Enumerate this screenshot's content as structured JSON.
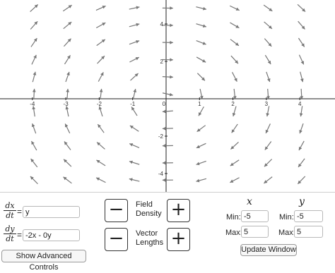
{
  "plot": {
    "x_ticks": [
      "-4",
      "-3",
      "-2",
      "-1",
      "0",
      "1",
      "2",
      "3",
      "4"
    ],
    "y_ticks": [
      "4",
      "2",
      "-2",
      "-4"
    ],
    "system": {
      "dx": "y",
      "dy": "-2x - 0y"
    },
    "arrow_color": "#777777",
    "axis_color": "#222222"
  },
  "equations": {
    "dx_top": "dx",
    "dx_bottom": "dt",
    "dx_value": "y",
    "dy_top": "dy",
    "dy_bottom": "dt",
    "dy_value": "-2x - 0y",
    "equals": "="
  },
  "controls": {
    "advanced_label": "Show Advanced Controls",
    "minus_symbol": "−",
    "plus_symbol": "+",
    "field_density_label": "Field\nDensity",
    "vector_lengths_label": "Vector\nLengths",
    "x_header": "x",
    "y_header": "y",
    "min_label": "Min:",
    "max_label": "Max:",
    "x_min": "-5",
    "x_max": "5",
    "y_min": "-5",
    "y_max": "5",
    "update_label": "Update Window"
  }
}
